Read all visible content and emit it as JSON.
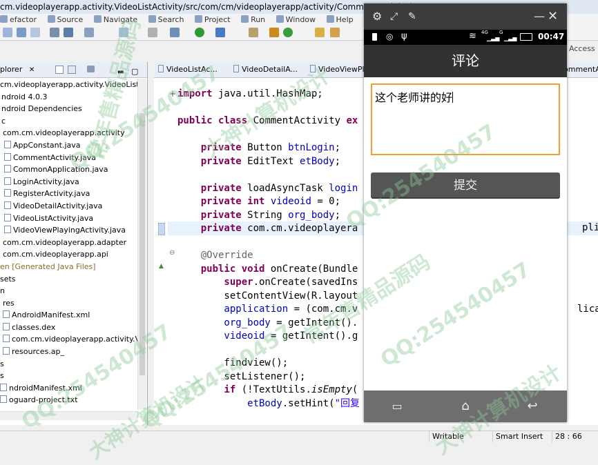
{
  "eclipse": {
    "title": "cm.videoplayerapp.activity.VideoListActivity/src/com/cm/videoplayerapp/activity/CommentActivity.java",
    "menu": [
      "efactor",
      "Source",
      "Navigate",
      "Search",
      "Project",
      "Run",
      "Window",
      "Help"
    ],
    "access_label": "Access",
    "explorer_title": "plorer",
    "explorer_close": "✕",
    "tree": [
      {
        "label": "cm.videoplayerapp.activity.VideoListAc",
        "kind": "project"
      },
      {
        "label": "ndroid 4.0.3",
        "kind": "lib"
      },
      {
        "label": "ndroid Dependencies",
        "kind": "lib"
      },
      {
        "label": "c",
        "kind": "folder"
      },
      {
        "label": "com.cm.videoplayerapp.activity",
        "kind": "package"
      },
      {
        "label": "AppConstant.java",
        "kind": "file"
      },
      {
        "label": "CommentActivity.java",
        "kind": "file"
      },
      {
        "label": "CommonApplication.java",
        "kind": "file"
      },
      {
        "label": "LoginActivity.java",
        "kind": "file"
      },
      {
        "label": "RegisterActivity.java",
        "kind": "file"
      },
      {
        "label": "VideoDetailActivity.java",
        "kind": "file"
      },
      {
        "label": "VideoListActivity.java",
        "kind": "file"
      },
      {
        "label": "VideoViewPlayingActivity.java",
        "kind": "file"
      },
      {
        "label": "com.cm.videoplayerapp.adapter",
        "kind": "package"
      },
      {
        "label": "com.cm.videoplayerapp.api",
        "kind": "package"
      },
      {
        "label": "en [Generated Java Files]",
        "kind": "gen"
      },
      {
        "label": "sets",
        "kind": "folder"
      },
      {
        "label": "n",
        "kind": "folder"
      },
      {
        "label": "res",
        "kind": "folder"
      },
      {
        "label": "AndroidManifest.xml",
        "kind": "file"
      },
      {
        "label": "classes.dex",
        "kind": "file"
      },
      {
        "label": "com.cm.videoplayerapp.activity.Video",
        "kind": "file"
      },
      {
        "label": "resources.ap_",
        "kind": "file"
      },
      {
        "label": "s",
        "kind": "folder"
      },
      {
        "label": "s",
        "kind": "folder"
      },
      {
        "label": "ndroidManifest.xml",
        "kind": "file"
      },
      {
        "label": "oguard-project.txt",
        "kind": "file"
      }
    ],
    "editor_tabs": [
      "VideoListAc...",
      "VideoDetailA...",
      "VideoViewPl...",
      "ommentA"
    ],
    "code": [
      {
        "parts": [
          {
            "t": "import",
            "c": "kw"
          },
          {
            "t": " java.util.HashMap;"
          }
        ]
      },
      {
        "parts": []
      },
      {
        "parts": [
          {
            "t": "public class",
            "c": "kw"
          },
          {
            "t": " CommentActivity "
          },
          {
            "t": "ex",
            "c": "kw"
          }
        ]
      },
      {
        "parts": []
      },
      {
        "parts": [
          {
            "t": "    private",
            "c": "kw"
          },
          {
            "t": " Button "
          },
          {
            "t": "btnLogin",
            "c": "fld"
          },
          {
            "t": ";"
          }
        ]
      },
      {
        "parts": [
          {
            "t": "    private",
            "c": "kw"
          },
          {
            "t": " EditText "
          },
          {
            "t": "etBody",
            "c": "fld"
          },
          {
            "t": ";"
          }
        ]
      },
      {
        "parts": []
      },
      {
        "parts": [
          {
            "t": "    private",
            "c": "kw"
          },
          {
            "t": " loadAsyncTask "
          },
          {
            "t": "login",
            "c": "fld"
          }
        ]
      },
      {
        "parts": [
          {
            "t": "    private int",
            "c": "kw"
          },
          {
            "t": " "
          },
          {
            "t": "videoid",
            "c": "fld"
          },
          {
            "t": " = 0;"
          }
        ]
      },
      {
        "parts": [
          {
            "t": "    private",
            "c": "kw"
          },
          {
            "t": " String "
          },
          {
            "t": "org_body",
            "c": "fld"
          },
          {
            "t": ";"
          }
        ]
      },
      {
        "parts": [
          {
            "t": "    private",
            "c": "kw"
          },
          {
            "t": " com.cm.videoplayera"
          }
        ]
      },
      {
        "parts": []
      },
      {
        "parts": [
          {
            "t": "    @Override",
            "c": "ann"
          }
        ]
      },
      {
        "parts": [
          {
            "t": "    public void",
            "c": "kw"
          },
          {
            "t": " onCreate(Bundle"
          }
        ]
      },
      {
        "parts": [
          {
            "t": "        super",
            "c": "kw"
          },
          {
            "t": ".onCreate(savedIns"
          }
        ]
      },
      {
        "parts": [
          {
            "t": "        setContentView(R.layout"
          }
        ]
      },
      {
        "parts": [
          {
            "t": "        application",
            "c": "fld"
          },
          {
            "t": " = (com.cm.v"
          }
        ]
      },
      {
        "parts": [
          {
            "t": "        org_body",
            "c": "fld"
          },
          {
            "t": " = getIntent()."
          }
        ]
      },
      {
        "parts": [
          {
            "t": "        videoid",
            "c": "fld"
          },
          {
            "t": " = getIntent().g"
          }
        ]
      },
      {
        "parts": []
      },
      {
        "parts": [
          {
            "t": "        findview();"
          }
        ]
      },
      {
        "parts": [
          {
            "t": "        setListener();"
          }
        ]
      },
      {
        "parts": [
          {
            "t": "        if",
            "c": "kw"
          },
          {
            "t": " (!TextUtils."
          },
          {
            "t": "isEmpty",
            "c": "mth-i"
          },
          {
            "t": "("
          }
        ]
      },
      {
        "parts": [
          {
            "t": "            etBody",
            "c": "fld"
          },
          {
            "t": ".setHint("
          },
          {
            "t": "\"回复",
            "c": "str"
          }
        ]
      }
    ],
    "right_overflow": [
      "plicat",
      "licati"
    ],
    "status": {
      "mode": "Writable",
      "insert": "Smart Insert",
      "position": "28 : 66"
    }
  },
  "emulator": {
    "status_time": "00:47",
    "signal_4g": "4G",
    "signal_g": "G",
    "app_title": "评论",
    "comment_text": "这个老师讲的好",
    "submit_label": "提交"
  },
  "watermark": {
    "qq": "QQ:254540457",
    "text1": "常年售精品源码",
    "text2": "大神计算机设计"
  },
  "colors": {
    "keyword": "#7f0055",
    "field": "#0000c0",
    "input_border": "#f0a030",
    "appbar": "#323232"
  }
}
